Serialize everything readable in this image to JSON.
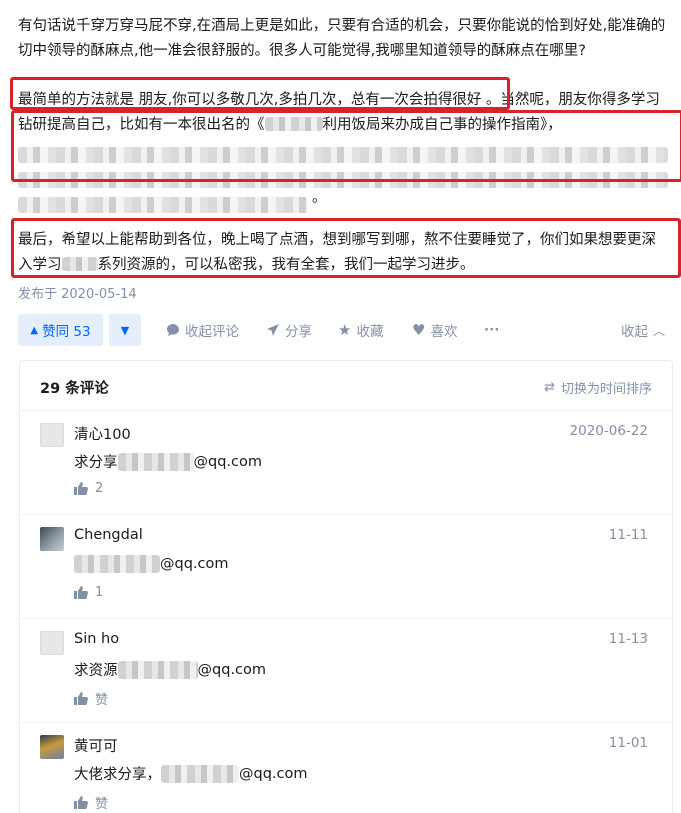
{
  "article": {
    "p1": "有句话说千穿万穿马屁不穿,在酒局上更是如此，只要有合适的机会，只要你能说的恰到好处,能准确的切中领导的酥麻点,他一准会很舒服的。很多人可能觉得,我哪里知道领导的酥麻点在哪里?",
    "p2_start": "最简单的方法就是 朋友,你可以多敬几次,多拍几次，总有一次会拍得很好 。当然呢，朋友你得多学习钻研提高自己，比如有一本很出名的《",
    "p2_title": "利用饭局来办成自己事的操作指南》，",
    "p2_end": "。",
    "p3_start": "最后，希望以上能帮助到各位，晚上喝了点酒，想到哪写到哪，熬不住要睡觉了，你们如果想要更深入学习",
    "p3_end": "系列资源的，可以私密我，我有全套，我们一起学习进步。"
  },
  "published": "发布于 2020-05-14",
  "actions": {
    "upvote_label": "赞同 53",
    "collapse_comments": "收起评论",
    "share": "分享",
    "favorite": "收藏",
    "like": "喜欢",
    "more": "···",
    "collapse": "收起"
  },
  "comments_panel": {
    "count_label": "29 条评论",
    "sort_label": "切换为时间排序",
    "items": [
      {
        "name": "清心100",
        "date": "2020-06-22",
        "prefix": "求分享",
        "suffix": "@qq.com",
        "likes": "2"
      },
      {
        "name": "Chengdal",
        "date": "11-11",
        "prefix": "",
        "suffix": "@qq.com",
        "likes": "1"
      },
      {
        "name": "Sin ho",
        "date": "11-13",
        "prefix": "求资源",
        "suffix": "@qq.com",
        "likes": "赞"
      },
      {
        "name": "黄可可",
        "date": "11-01",
        "prefix": "大佬求分享，",
        "suffix": "@qq.com",
        "likes": "赞"
      }
    ]
  },
  "colors": {
    "highlight_box": "#d8232a",
    "accent_blue": "#0066ff",
    "vote_bg": "#e5eefc",
    "muted": "#8590a6"
  },
  "icons": [
    "triangle-up-icon",
    "triangle-down-icon",
    "comment-icon",
    "share-icon",
    "star-icon",
    "heart-icon",
    "more-icon",
    "chevron-up-icon",
    "swap-icon",
    "thumb-up-icon"
  ]
}
